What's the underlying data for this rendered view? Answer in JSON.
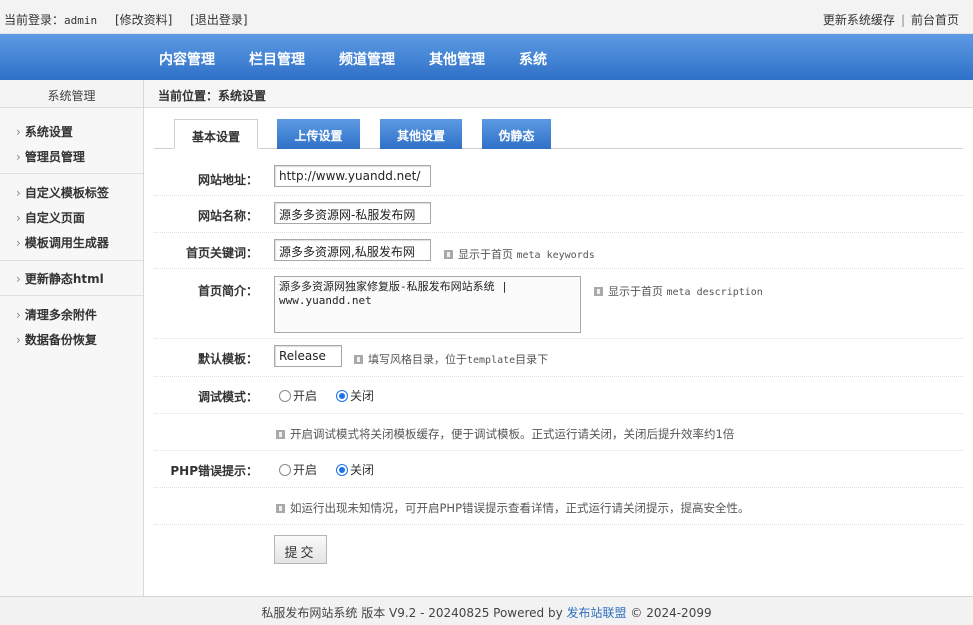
{
  "topbar": {
    "login_prefix": "当前登录：",
    "username": "admin",
    "edit_profile": "[修改资料]",
    "logout": "[退出登录]",
    "update_cache": "更新系统缓存",
    "separator": "|",
    "front_home": "前台首页"
  },
  "nav": {
    "items": [
      "内容管理",
      "栏目管理",
      "频道管理",
      "其他管理",
      "系统"
    ]
  },
  "sidebar": {
    "title": "系统管理",
    "groups": [
      [
        "系统设置",
        "管理员管理"
      ],
      [
        "自定义模板标签",
        "自定义页面",
        "模板调用生成器"
      ],
      [
        "更新静态html"
      ],
      [
        "清理多余附件",
        "数据备份恢复"
      ]
    ]
  },
  "breadcrumb": "当前位置：系统设置",
  "tabs": [
    "基本设置",
    "上传设置",
    "其他设置",
    "伪静态"
  ],
  "form": {
    "site_url": {
      "label": "网站地址：",
      "value": "http://www.yuandd.net/"
    },
    "site_name": {
      "label": "网站名称：",
      "value": "源多多资源网-私服发布网"
    },
    "keywords": {
      "label": "首页关键词：",
      "value": "源多多资源网,私服发布网",
      "hint_text": "显示于首页",
      "hint_code": "meta keywords"
    },
    "description": {
      "label": "首页简介：",
      "value": "源多多资源网独家修复版-私服发布网站系统 | www.yuandd.net",
      "hint_text": "显示于首页",
      "hint_code": "meta description"
    },
    "template": {
      "label": "默认模板：",
      "value": "Release",
      "hint_prefix": "填写风格目录，位于",
      "hint_code": "template",
      "hint_suffix": "目录下"
    },
    "debug": {
      "label": "调试模式：",
      "on": "开启",
      "off": "关闭",
      "selected": "off",
      "hint": "开启调试模式将关闭模板缓存，便于调试模板。正式运行请关闭，关闭后提升效率约1倍"
    },
    "php_error": {
      "label": "PHP错误提示：",
      "on": "开启",
      "off": "关闭",
      "selected": "off",
      "hint": "如运行出现未知情况，可开启PHP错误提示查看详情，正式运行请关闭提示，提高安全性。"
    },
    "submit": "提交"
  },
  "footer": {
    "text": "私服发布网站系统 版本 V9.2 - 20240825 Powered by",
    "link": "发布站联盟",
    "copyright": "© 2024-2099"
  },
  "colors": {
    "nav_blue": "#3d7fd4",
    "accent_radio": "#1a73e8"
  }
}
